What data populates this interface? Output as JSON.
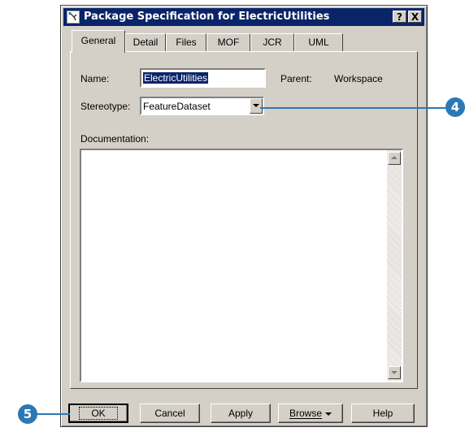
{
  "window": {
    "title": "Package Specification for ElectricUtilities",
    "help_btn": "?",
    "close_btn": "X"
  },
  "tabs": [
    {
      "label": "General",
      "active": true
    },
    {
      "label": "Detail",
      "active": false
    },
    {
      "label": "Files",
      "active": false
    },
    {
      "label": "MOF",
      "active": false
    },
    {
      "label": "JCR",
      "active": false
    },
    {
      "label": "UML",
      "active": false
    }
  ],
  "general": {
    "name_label": "Name:",
    "name_value": "ElectricUtilities",
    "parent_label": "Parent:",
    "parent_value": "Workspace",
    "stereotype_label": "Stereotype:",
    "stereotype_value": "FeatureDataset",
    "documentation_label": "Documentation:",
    "documentation_value": ""
  },
  "buttons": {
    "ok": "OK",
    "cancel": "Cancel",
    "apply": "Apply",
    "browse": "Browse",
    "help": "Help"
  },
  "callouts": {
    "stereotype": "4",
    "ok": "5"
  },
  "colors": {
    "titlebar": "#0a246a",
    "callout": "#2b78b5",
    "face": "#d4d0c8"
  }
}
